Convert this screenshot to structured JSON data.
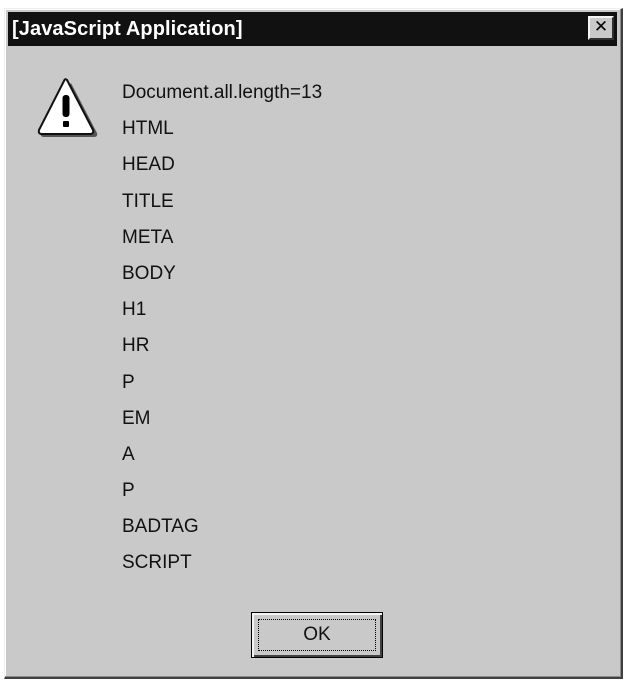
{
  "dialog": {
    "title": "[JavaScript Application]",
    "close_label": "✕",
    "icon": "warning-icon",
    "message_lines": [
      "Document.all.length=13",
      "HTML",
      "HEAD",
      "TITLE",
      "META",
      "BODY",
      "H1",
      "HR",
      "P",
      "EM",
      "A",
      "P",
      "BADTAG",
      "SCRIPT"
    ],
    "ok_label": "OK"
  },
  "colors": {
    "dialog_face": "#c9c9c9",
    "titlebar": "#111111",
    "title_text": "#ffffff",
    "warning_fill": "#ffffff",
    "text": "#111111"
  }
}
